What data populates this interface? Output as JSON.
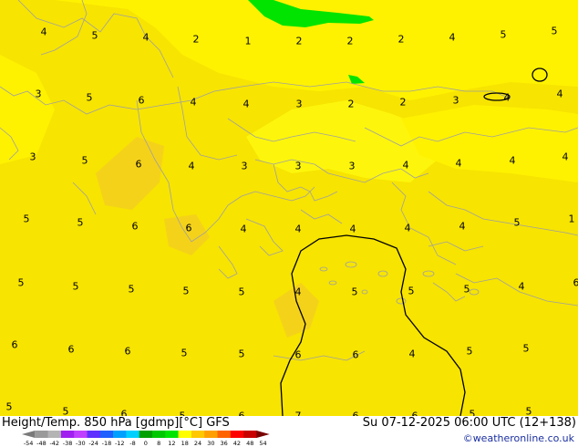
{
  "map": {
    "colors": {
      "warm_yellow": "#f7e400",
      "light_yellow": "#fff200",
      "pale_yellow": "#fdf60c",
      "orange_tint": "#f5d21a",
      "green": "#00e400",
      "coastline": "#a0a0a0",
      "contour": "#000000"
    },
    "value_labels": [
      {
        "v": "4"
      },
      {
        "v": "5"
      },
      {
        "v": "4"
      },
      {
        "v": "2"
      },
      {
        "v": "1"
      },
      {
        "v": "2"
      },
      {
        "v": "2"
      },
      {
        "v": "2"
      },
      {
        "v": "4"
      },
      {
        "v": "5"
      },
      {
        "v": "5"
      },
      {
        "v": "3"
      },
      {
        "v": "5"
      },
      {
        "v": "6"
      },
      {
        "v": "4"
      },
      {
        "v": "4"
      },
      {
        "v": "3"
      },
      {
        "v": "2"
      },
      {
        "v": "2"
      },
      {
        "v": "3"
      },
      {
        "v": "4"
      },
      {
        "v": "4"
      },
      {
        "v": "3"
      },
      {
        "v": "5"
      },
      {
        "v": "6"
      },
      {
        "v": "4"
      },
      {
        "v": "3"
      },
      {
        "v": "3"
      },
      {
        "v": "3"
      },
      {
        "v": "4"
      },
      {
        "v": "4"
      },
      {
        "v": "4"
      },
      {
        "v": "4"
      },
      {
        "v": "5"
      },
      {
        "v": "5"
      },
      {
        "v": "6"
      },
      {
        "v": "6"
      },
      {
        "v": "4"
      },
      {
        "v": "4"
      },
      {
        "v": "4"
      },
      {
        "v": "4"
      },
      {
        "v": "4"
      },
      {
        "v": "5"
      },
      {
        "v": "1"
      },
      {
        "v": "5"
      },
      {
        "v": "5"
      },
      {
        "v": "5"
      },
      {
        "v": "5"
      },
      {
        "v": "5"
      },
      {
        "v": "4"
      },
      {
        "v": "5"
      },
      {
        "v": "5"
      },
      {
        "v": "5"
      },
      {
        "v": "4"
      },
      {
        "v": "6"
      },
      {
        "v": "6"
      },
      {
        "v": "6"
      },
      {
        "v": "6"
      },
      {
        "v": "5"
      },
      {
        "v": "5"
      },
      {
        "v": "6"
      },
      {
        "v": "6"
      },
      {
        "v": "4"
      },
      {
        "v": "5"
      },
      {
        "v": "5"
      },
      {
        "v": "5"
      },
      {
        "v": "5"
      },
      {
        "v": "6"
      },
      {
        "v": "5"
      },
      {
        "v": "6"
      },
      {
        "v": "7"
      },
      {
        "v": "6"
      },
      {
        "v": "6"
      },
      {
        "v": "5"
      },
      {
        "v": "5"
      }
    ]
  },
  "footer": {
    "product_title": "Height/Temp. 850 hPa [gdmp][°C] GFS",
    "valid_time": "Su 07-12-2025 06:00 UTC (12+138)",
    "copyright": "©weatheronline.co.uk"
  },
  "colorbar": {
    "ticks": [
      "-54",
      "-48",
      "-42",
      "-38",
      "-30",
      "-24",
      "-18",
      "-12",
      "-8",
      "0",
      "8",
      "12",
      "18",
      "24",
      "30",
      "36",
      "42",
      "48",
      "54"
    ],
    "colors": [
      "#7a7a7a",
      "#9a9a9a",
      "#b4b4b4",
      "#a020f0",
      "#c040ff",
      "#6030ff",
      "#2060ff",
      "#00a0ff",
      "#00d0ff",
      "#00a000",
      "#00c800",
      "#00e400",
      "#ffff00",
      "#ffc800",
      "#ffa000",
      "#ff6400",
      "#ff0000",
      "#c80000",
      "#780000"
    ]
  }
}
